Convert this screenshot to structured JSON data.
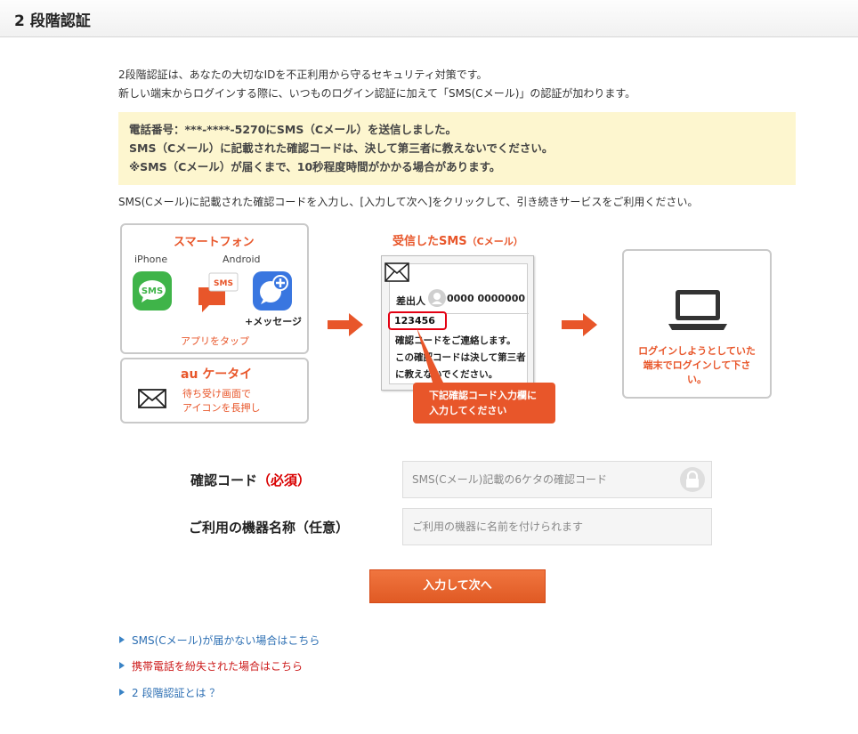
{
  "header": {
    "title": "2 段階認証"
  },
  "intro": {
    "line1": "2段階認証は、あなたの大切なIDを不正利用から守るセキュリティ対策です。",
    "line2": "新しい端末からログインする際に、いつものログイン認証に加えて「SMS(Cメール)」の認証が加わります。"
  },
  "notice": {
    "line1": "電話番号：***-****-5270にSMS（Cメール）を送信しました。",
    "line2": "SMS（Cメール）に記載された確認コードは、決して第三者に教えないでください。",
    "line3": "※SMS（Cメール）が届くまで、10秒程度時間がかかる場合があります。"
  },
  "instruction": "SMS(Cメール)に記載された確認コードを入力し、[入力して次へ]をクリックして、引き続きサービスをご利用ください。",
  "smartphone_card": {
    "title": "スマートフォン",
    "iphone_label": "iPhone",
    "android_label": "Android",
    "sms_icon_text": "SMS",
    "sms_bubble_text": "SMS",
    "plus_message_label": "+メッセージ",
    "caption": "アプリをタップ"
  },
  "au_card": {
    "title": "au ケータイ",
    "caption_line1": "待ち受け画面で",
    "caption_line2": "アイコンを長押し"
  },
  "sms_example": {
    "title": "受信したSMS",
    "title_suffix": "（Cメール）",
    "sender_label": "差出人",
    "sender_number": "0000 0000000",
    "code": "123456",
    "body_line1": "確認コードをご連絡します。",
    "body_line2": "この確認コードは決して第三者",
    "body_line3": "に教えないでください。",
    "callout_line1": "下記確認コード入力欄に",
    "callout_line2": "入力してください"
  },
  "login_card": {
    "line1": "ログインしようとしていた",
    "line2": "端末でログインして下さい。"
  },
  "form": {
    "code_label": "確認コード",
    "code_required": "（必須）",
    "code_placeholder": "SMS(Cメール)記載の6ケタの確認コード",
    "device_label": "ご利用の機器名称（任意）",
    "device_placeholder": "ご利用の機器に名前を付けられます",
    "submit_label": "入力して次へ"
  },
  "links": [
    {
      "label": "SMS(Cメール)が届かない場合はこちら"
    },
    {
      "label": "携帯電話を紛失された場合はこちら"
    },
    {
      "label": "2 段階認証とは ？"
    }
  ],
  "colors": {
    "accent": "#e8562a",
    "link": "#2d6fb3",
    "link_alert": "#cc1a1a",
    "notice_bg": "#fdf6cf"
  }
}
